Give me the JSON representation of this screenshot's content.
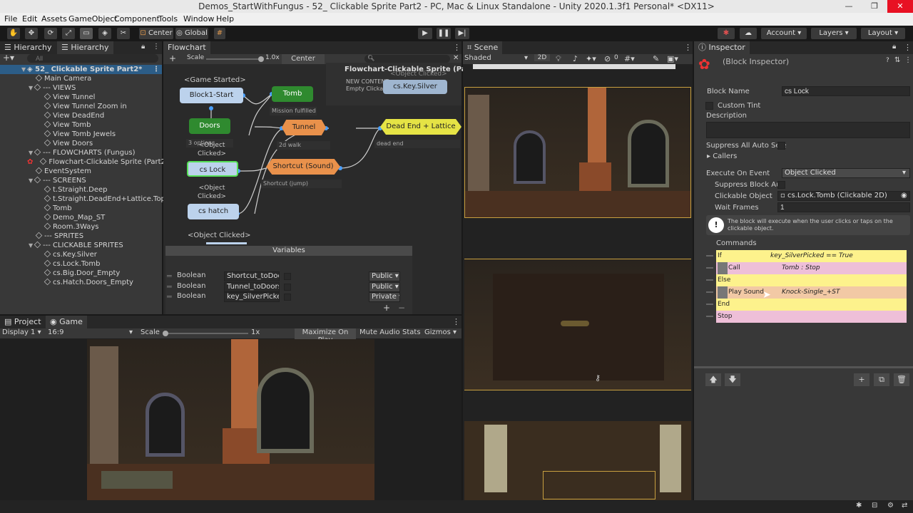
{
  "window": {
    "title": "Demos_StartWithFungus - 52_ Clickable Sprite Part2 - PC, Mac & Linux Standalone - Unity 2020.1.3f1 Personal* <DX11>"
  },
  "menu": [
    "File",
    "Edit",
    "Assets",
    "GameObject",
    "Component",
    "Tools",
    "Window",
    "Help"
  ],
  "toolbar": {
    "center": "Center",
    "global": "Global",
    "account": "Account",
    "layers": "Layers",
    "layout": "Layout"
  },
  "hierarchy": {
    "tab1": "Hierarchy",
    "tab2": "Hierarchy",
    "search_placeholder": "All",
    "scene": "52_ Clickable Sprite Part2*",
    "items": [
      "Main Camera",
      "--- VIEWS",
      "View Tunnel",
      "View Tunnel Zoom in",
      "View DeadEnd",
      "View Tomb",
      "View Tomb Jewels",
      "View Doors",
      "--- FLOWCHARTS (Fungus)",
      "Flowchart-Clickable Sprite (Part2)",
      "EventSystem",
      "--- SCREENS",
      "t.Straight.Deep",
      "t.Straight.DeadEnd+Lattice.Toppn",
      "Tomb",
      "Demo_Map_ST",
      "Room.3Ways",
      "--- SPRITES",
      "--- CLICKABLE SPRITES",
      "cs.Key.Silver",
      "cs.Lock.Tomb",
      "cs.Big.Door_Empty",
      "cs.Hatch.Doors_Empty"
    ]
  },
  "flowchart": {
    "tab": "Flowchart",
    "scale_label": "Scale",
    "scale_value": "1.0x",
    "center": "Center",
    "title": "Flowchart-Clickable Sprite (Part2)",
    "overlay": [
      "NEW CONTENT",
      "Empty Clicka..."
    ],
    "event_labels": [
      "<Game Started>",
      "<Object Clicked>",
      "<Object Clicked>",
      "<Object Clicked>",
      "<Object Clicked>"
    ],
    "blocks": [
      "Block1-Start",
      "Tomb",
      "Doors",
      "Tunnel",
      "Dead End + Lattice",
      "cs Lock",
      "Shortcut (Sound)",
      "cs hatch",
      "cs.Key.Silver"
    ],
    "descriptions": [
      "Mission fulfilled",
      "3 options",
      "2d walk",
      "dead end",
      "Shortcut (jump)"
    ],
    "variables_title": "Variables",
    "variables": [
      {
        "type": "Boolean",
        "name": "Shortcut_toDoor",
        "scope": "Public"
      },
      {
        "type": "Boolean",
        "name": "Tunnel_toDoors",
        "scope": "Public"
      },
      {
        "type": "Boolean",
        "name": "key_SilverPicked",
        "scope": "Private"
      }
    ]
  },
  "scene": {
    "tab": "Scene",
    "shading": "Shaded",
    "mode2d": "2D",
    "gizmo_count": "0"
  },
  "project_tab": "Project",
  "game": {
    "tab": "Game",
    "display": "Display 1",
    "aspect": "16:9",
    "scale_label": "Scale",
    "scale_value": "1x",
    "maximize": "Maximize On Play",
    "mute": "Mute Audio",
    "stats": "Stats",
    "gizmos": "Gizmos"
  },
  "inspector": {
    "tab": "Inspector",
    "header": "(Block Inspector)",
    "block_name_label": "Block Name",
    "block_name": "cs Lock",
    "custom_tint": "Custom Tint",
    "description": "Description",
    "suppress": "Suppress All Auto Sele",
    "callers": "Callers",
    "execute_label": "Execute On Event",
    "execute_value": "Object Clicked",
    "suppress_block": "Suppress Block Aut",
    "clickable_label": "Clickable Object",
    "clickable_value": "cs.Lock.Tomb (Clickable 2D)",
    "wait_label": "Wait Frames",
    "wait_value": "1",
    "help": "The block will execute when the user clicks or taps on the clickable object.",
    "commands_title": "Commands",
    "commands": [
      {
        "name": "If",
        "summary": "key_SilverPicked == True",
        "color": "#fdf28c"
      },
      {
        "name": "Call",
        "summary": "Tomb : Stop",
        "color": "#eebfd8"
      },
      {
        "name": "Else",
        "summary": "",
        "color": "#fdf28c"
      },
      {
        "name": "Play Sound",
        "summary": "Knock-Single_+ST",
        "color": "#f2c9a5"
      },
      {
        "name": "End",
        "summary": "",
        "color": "#fdf28c"
      },
      {
        "name": "Stop",
        "summary": "",
        "color": "#eebfd8"
      }
    ]
  }
}
